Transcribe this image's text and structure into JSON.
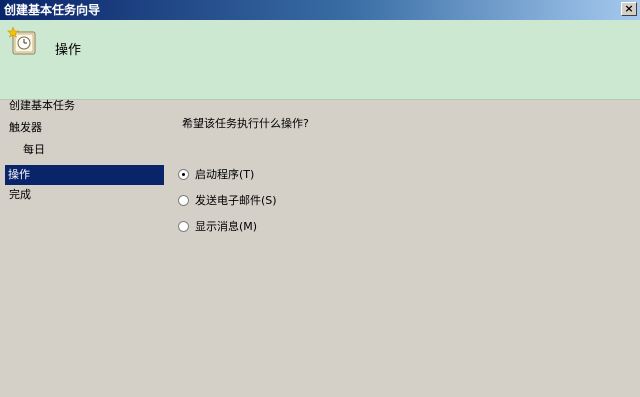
{
  "window": {
    "title": "创建基本任务向导",
    "close_glyph": "×"
  },
  "header": {
    "title": "操作",
    "icon": "scheduled-task-clock-icon"
  },
  "nav": {
    "items": [
      {
        "label": "创建基本任务",
        "selected": false
      },
      {
        "label": "触发器",
        "selected": false
      },
      {
        "label": "每日",
        "selected": false
      },
      {
        "label": "操作",
        "selected": true
      },
      {
        "label": "完成",
        "selected": false
      }
    ]
  },
  "main": {
    "question": "希望该任务执行什么操作?",
    "options": [
      {
        "label": "启动程序(T)",
        "checked": true
      },
      {
        "label": "发送电子邮件(S)",
        "checked": false
      },
      {
        "label": "显示消息(M)",
        "checked": false
      }
    ]
  },
  "colors": {
    "header_bg": "#cde8d1",
    "selected_bg": "#0a246a",
    "dialog_bg": "#d4d0c8"
  }
}
